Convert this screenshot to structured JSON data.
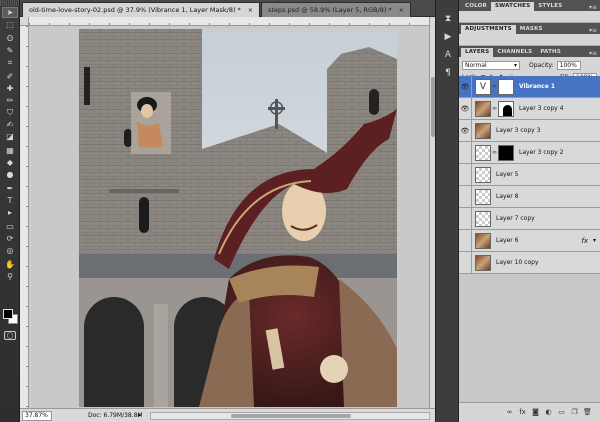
{
  "document": {
    "tabs": [
      {
        "label": "old-time-love-story-02.psd @ 37.9% (Vibrance 1, Layer Mask/8) *",
        "close": "×",
        "active": true
      },
      {
        "label": "steps.psd @ 58.9% (Layer 5, RGB/8) *",
        "close": "×",
        "active": false
      }
    ],
    "zoom": "37.87%",
    "doc_size": "Doc: 6.79M/38.8M",
    "status_arrow": "▸"
  },
  "tools": [
    {
      "icon": "move-tool-icon",
      "glyph": "➤"
    },
    {
      "icon": "marquee-tool-icon",
      "glyph": "⬚"
    },
    {
      "icon": "lasso-tool-icon",
      "glyph": "ʘ"
    },
    {
      "icon": "quick-select-tool-icon",
      "glyph": "✎"
    },
    {
      "icon": "crop-tool-icon",
      "glyph": "⌗"
    },
    {
      "icon": "eyedropper-tool-icon",
      "glyph": "✐"
    },
    {
      "icon": "healing-brush-tool-icon",
      "glyph": "✚"
    },
    {
      "icon": "brush-tool-icon",
      "glyph": "✏"
    },
    {
      "icon": "clone-stamp-tool-icon",
      "glyph": "⛉"
    },
    {
      "icon": "history-brush-tool-icon",
      "glyph": "✍"
    },
    {
      "icon": "eraser-tool-icon",
      "glyph": "◪"
    },
    {
      "icon": "gradient-tool-icon",
      "glyph": "▦"
    },
    {
      "icon": "blur-tool-icon",
      "glyph": "◆"
    },
    {
      "icon": "dodge-tool-icon",
      "glyph": "●"
    },
    {
      "icon": "pen-tool-icon",
      "glyph": "✒"
    },
    {
      "icon": "type-tool-icon",
      "glyph": "T"
    },
    {
      "icon": "path-select-tool-icon",
      "glyph": "▸"
    },
    {
      "icon": "shape-tool-icon",
      "glyph": "▭"
    },
    {
      "icon": "3d-rotate-tool-icon",
      "glyph": "⟳"
    },
    {
      "icon": "3d-orbit-tool-icon",
      "glyph": "◎"
    },
    {
      "icon": "hand-tool-icon",
      "glyph": "✋"
    },
    {
      "icon": "zoom-tool-icon",
      "glyph": "⚲"
    }
  ],
  "colors": {
    "foreground": "#000000",
    "background": "#ffffff",
    "selected_layer": "#4673c4"
  },
  "dock": [
    {
      "icon": "history-panel-icon",
      "glyph": "⧗"
    },
    {
      "icon": "actions-panel-icon",
      "glyph": "▶"
    },
    {
      "icon": "character-panel-icon",
      "glyph": "A"
    },
    {
      "icon": "paragraph-panel-icon",
      "glyph": "¶"
    }
  ],
  "panels": {
    "color_group": {
      "tabs": [
        "COLOR",
        "SWATCHES",
        "STYLES"
      ],
      "active": "SWATCHES",
      "menu": "▾≡"
    },
    "adjust_group": {
      "tabs": [
        "ADJUSTMENTS",
        "MASKS"
      ],
      "active": "ADJUSTMENTS",
      "menu": "▾≡"
    },
    "layers_group": {
      "tabs": [
        "LAYERS",
        "CHANNELS",
        "PATHS"
      ],
      "active": "LAYERS",
      "menu": "▾≡"
    },
    "blend_mode": "Normal",
    "opacity_label": "Opacity:",
    "opacity_value": "100%",
    "lock_label": "Lock:",
    "lock_icons": "⊡ ✎ ✥ 🔒",
    "fill_label": "Fill:",
    "fill_value": "100%",
    "layers": [
      {
        "name": "Vibrance 1",
        "visible": true,
        "selected": true,
        "thumb": "vib",
        "mask": "white",
        "linked": true
      },
      {
        "name": "Layer 3 copy 4",
        "visible": true,
        "selected": false,
        "thumb": "photo",
        "mask": "shape",
        "linked": true
      },
      {
        "name": "Layer 3 copy 3",
        "visible": true,
        "selected": false,
        "thumb": "photo",
        "mask": "",
        "linked": false
      },
      {
        "name": "Layer 3 copy 2",
        "visible": false,
        "selected": false,
        "thumb": "trans",
        "mask": "black",
        "linked": true
      },
      {
        "name": "Layer 5",
        "visible": false,
        "selected": false,
        "thumb": "trans",
        "mask": "",
        "linked": false
      },
      {
        "name": "Layer 8",
        "visible": false,
        "selected": false,
        "thumb": "trans",
        "mask": "",
        "linked": false
      },
      {
        "name": "Layer 7 copy",
        "visible": false,
        "selected": false,
        "thumb": "trans",
        "mask": "",
        "linked": false
      },
      {
        "name": "Layer 6",
        "visible": false,
        "selected": false,
        "thumb": "photo",
        "mask": "",
        "linked": false,
        "fx": "fx",
        "fx_arrow": "▾"
      },
      {
        "name": "Layer 10 copy",
        "visible": false,
        "selected": false,
        "thumb": "photo",
        "mask": "",
        "linked": false
      }
    ],
    "footer_icons": [
      {
        "name": "link-layers-icon",
        "glyph": "∞"
      },
      {
        "name": "layer-style-icon",
        "glyph": "fx"
      },
      {
        "name": "add-mask-icon",
        "glyph": "◙"
      },
      {
        "name": "adjustment-layer-icon",
        "glyph": "◐"
      },
      {
        "name": "new-group-icon",
        "glyph": "▭"
      },
      {
        "name": "new-layer-icon",
        "glyph": "❐"
      },
      {
        "name": "delete-layer-icon",
        "glyph": "🗑"
      }
    ]
  }
}
